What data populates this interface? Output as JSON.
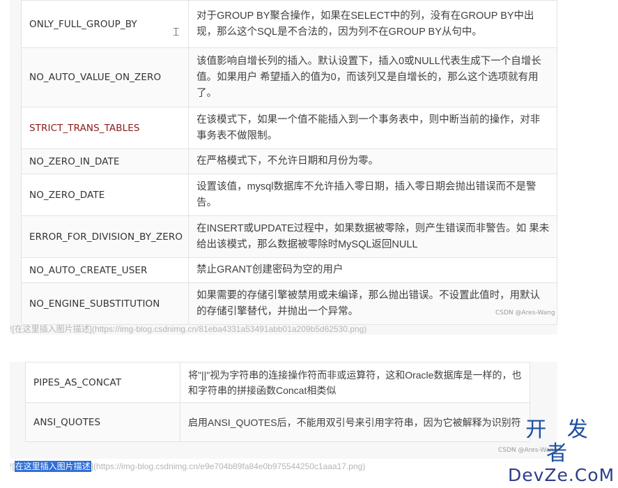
{
  "table1": {
    "rows": [
      {
        "key": "ONLY_FULL_GROUP_BY",
        "desc": "对于GROUP BY聚合操作，如果在SELECT中的列，没有在GROUP BY中出现，那么这个SQL是不合法的，因为列不在GROUP BY从句中。"
      },
      {
        "key": "NO_AUTO_VALUE_ON_ZERO",
        "desc": "该值影响自增长列的插入。默认设置下，插入0或NULL代表生成下一个自增长值。如果用户 希望插入的值为0，而该列又是自增长的，那么这个选项就有用了。"
      },
      {
        "key": "STRICT_TRANS_TABLES",
        "desc": "在该模式下，如果一个值不能插入到一个事务表中，则中断当前的操作，对非事务表不做限制。"
      },
      {
        "key": "NO_ZERO_IN_DATE",
        "desc": "在严格模式下，不允许日期和月份为零。"
      },
      {
        "key": "NO_ZERO_DATE",
        "desc": "设置该值，mysql数据库不允许插入零日期，插入零日期会抛出错误而不是警告。"
      },
      {
        "key": "ERROR_FOR_DIVISION_BY_ZERO",
        "desc": "在INSERT或UPDATE过程中，如果数据被零除，则产生错误而非警告。如 果未给出该模式，那么数据被零除时MySQL返回NULL"
      },
      {
        "key": "NO_AUTO_CREATE_USER",
        "desc": "禁止GRANT创建密码为空的用户"
      },
      {
        "key": "NO_ENGINE_SUBSTITUTION",
        "desc": "如果需要的存储引擎被禁用或未编译，那么抛出错误。不设置此值时，用默认的存储引擎替代，并抛出一个异常。"
      }
    ],
    "watermark": "CSDN @Ares-Wang",
    "caption": "![在这里插入图片描述](https://img-blog.csdnimg.cn/81eba4331a53491abb01a209b5d62530.png)"
  },
  "table2": {
    "rows": [
      {
        "key": "PIPES_AS_CONCAT",
        "desc": "将\"||\"视为字符串的连接操作符而非或运算符，这和Oracle数据库是一样的，也和字符串的拼接函数Concat相类似"
      },
      {
        "key": "ANSI_QUOTES",
        "desc": "启用ANSI_QUOTES后，不能用双引号来引用字符串，因为它被解释为识别符"
      }
    ],
    "watermark": "CSDN @Ares-Wang",
    "caption_prefix": "![",
    "caption_selected": "在这里插入图片描述",
    "caption_suffix": "](https://img-blog.csdnimg.cn/e9e704b89fa84e0b975544250c1aaa17.png)"
  },
  "logo": {
    "top": "开 发 者",
    "bottom": "DevZe.CoM"
  },
  "colors": {
    "highlight_key": "#8b1a1a",
    "selection": "#2f6fd8",
    "logo": "#1b4fa0"
  },
  "icons": {
    "cursor": "text-cursor-icon"
  }
}
